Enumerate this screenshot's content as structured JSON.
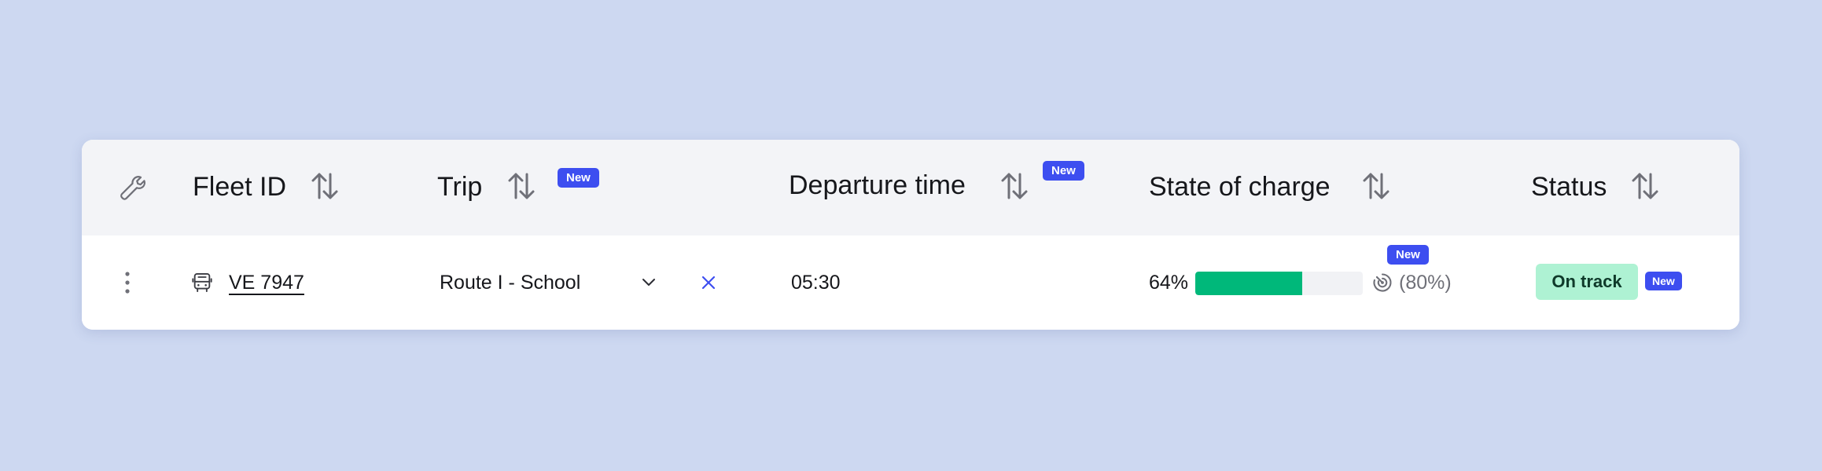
{
  "table": {
    "columns": [
      {
        "key": "tools",
        "icon": "wrench-icon"
      },
      {
        "key": "fleet_id",
        "label": "Fleet ID",
        "sortable": true
      },
      {
        "key": "trip",
        "label": "Trip",
        "sortable": true,
        "badge": "New"
      },
      {
        "key": "departure",
        "label": "Departure time",
        "sortable": true,
        "badge": "New"
      },
      {
        "key": "soc",
        "label": "State of charge",
        "sortable": true
      },
      {
        "key": "status",
        "label": "Status",
        "sortable": true
      }
    ],
    "rows": [
      {
        "fleet_id": "VE 7947",
        "vehicle_icon": "bus-icon",
        "trip": "Route I - School",
        "departure": "05:30",
        "soc_label": "64%",
        "soc_percent": 64,
        "soc_target": "(80%)",
        "soc_target_badge": "New",
        "status": "On track",
        "status_badge": "New"
      }
    ]
  },
  "colors": {
    "background": "#cdd8f1",
    "header_bg": "#f3f4f7",
    "accent_badge": "#3d4ef0",
    "soc_fill": "#00b87a",
    "status_chip_bg": "#aef2d3",
    "clear_icon": "#3d4ef0"
  }
}
